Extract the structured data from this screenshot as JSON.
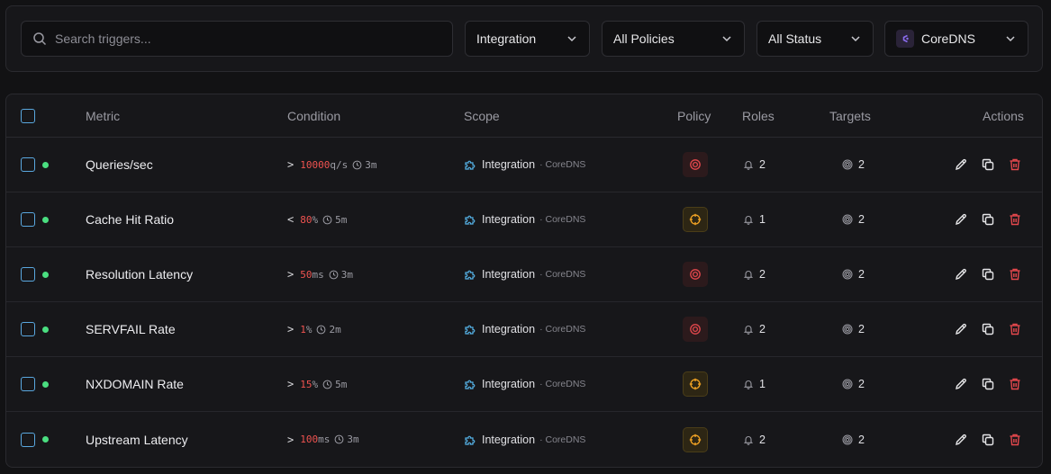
{
  "filters": {
    "search_placeholder": "Search triggers...",
    "type": "Integration",
    "policy": "All Policies",
    "status": "All Status",
    "integration": "CoreDNS"
  },
  "table": {
    "headers": {
      "metric": "Metric",
      "condition": "Condition",
      "scope": "Scope",
      "policy": "Policy",
      "roles": "Roles",
      "targets": "Targets",
      "actions": "Actions"
    },
    "rows": [
      {
        "metric": "Queries/sec",
        "op": ">",
        "value": "10000",
        "unit": "q/s",
        "duration": "3m",
        "scope": "Integration",
        "scope_sub": "· CoreDNS",
        "policy": "critical",
        "roles": "2",
        "targets": "2"
      },
      {
        "metric": "Cache Hit Ratio",
        "op": "<",
        "value": "80",
        "unit": "%",
        "duration": "5m",
        "scope": "Integration",
        "scope_sub": "· CoreDNS",
        "policy": "warning",
        "roles": "1",
        "targets": "2"
      },
      {
        "metric": "Resolution Latency",
        "op": ">",
        "value": "50",
        "unit": "ms",
        "duration": "3m",
        "scope": "Integration",
        "scope_sub": "· CoreDNS",
        "policy": "critical",
        "roles": "2",
        "targets": "2"
      },
      {
        "metric": "SERVFAIL Rate",
        "op": ">",
        "value": "1",
        "unit": "%",
        "duration": "2m",
        "scope": "Integration",
        "scope_sub": "· CoreDNS",
        "policy": "critical",
        "roles": "2",
        "targets": "2"
      },
      {
        "metric": "NXDOMAIN Rate",
        "op": ">",
        "value": "15",
        "unit": "%",
        "duration": "5m",
        "scope": "Integration",
        "scope_sub": "· CoreDNS",
        "policy": "warning",
        "roles": "1",
        "targets": "2"
      },
      {
        "metric": "Upstream Latency",
        "op": ">",
        "value": "100",
        "unit": "ms",
        "duration": "3m",
        "scope": "Integration",
        "scope_sub": "· CoreDNS",
        "policy": "warning",
        "roles": "2",
        "targets": "2"
      }
    ]
  },
  "colors": {
    "status_active": "#4ade80",
    "condition_value": "#ef5350",
    "policy_critical": "#e5484d",
    "policy_warning": "#f5a524",
    "delete": "#e5484d",
    "checkbox": "#5aa8e0"
  },
  "icons": {
    "search": "search-icon",
    "chevron": "chevron-down-icon",
    "clock": "clock-icon",
    "scope": "puzzle-icon",
    "policy_critical": "target-icon",
    "policy_warning": "crosshair-icon",
    "roles": "bell-icon",
    "targets": "target-icon",
    "edit": "pencil-icon",
    "duplicate": "copy-icon",
    "delete": "trash-icon"
  }
}
